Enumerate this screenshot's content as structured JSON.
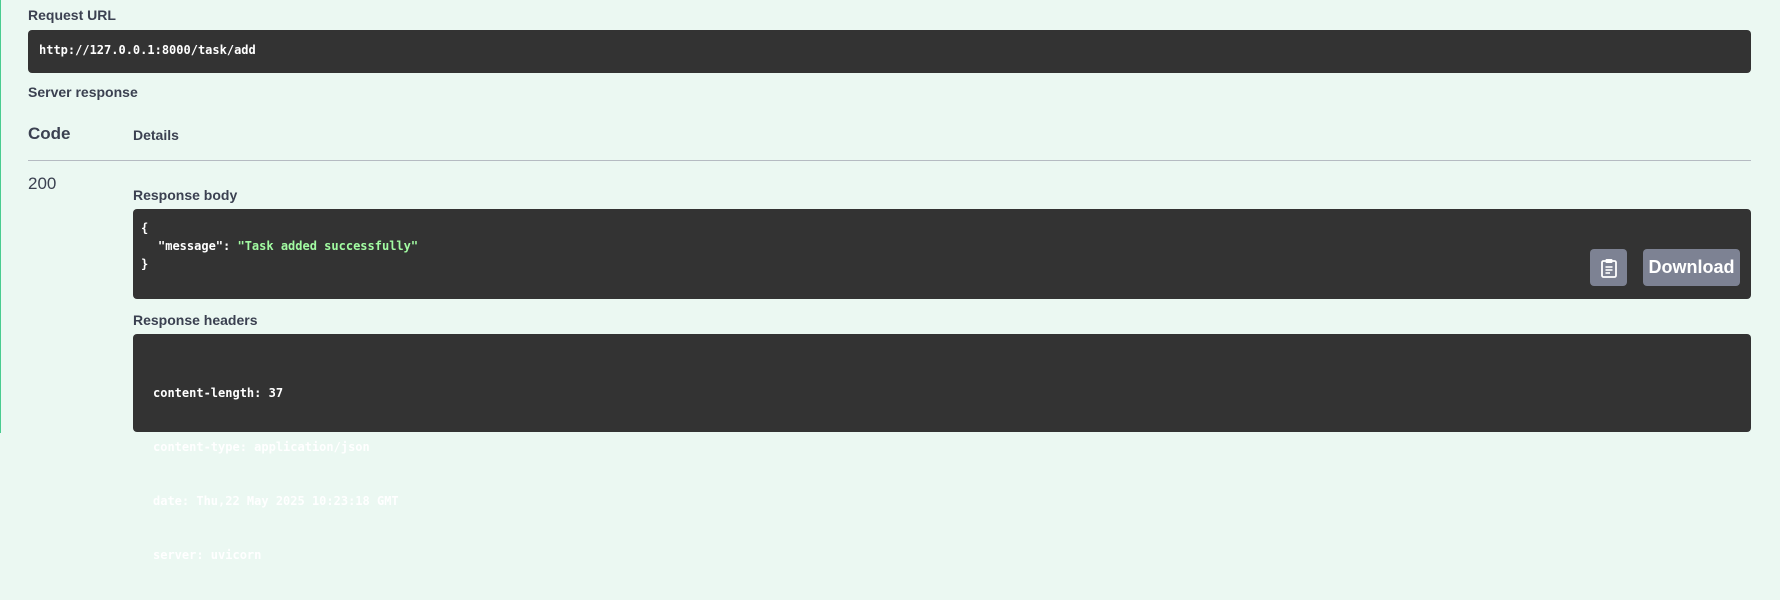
{
  "request": {
    "label": "Request URL",
    "url": "http://127.0.0.1:8000/task/add"
  },
  "response": {
    "label": "Server response",
    "columns": {
      "code": "Code",
      "details": "Details"
    },
    "status_code": "200",
    "body_label": "Response body",
    "body": {
      "open_brace": "{",
      "key": "\"message\"",
      "colon": ": ",
      "value": "\"Task added successfully\"",
      "close_brace": "}"
    },
    "headers_label": "Response headers",
    "headers": [
      "content-length: 37",
      "content-type: application/json",
      "date: Thu,22 May 2025 10:23:18 GMT",
      "server: uvicorn"
    ],
    "download_label": "Download",
    "copy_icon": "clipboard-icon"
  },
  "colors": {
    "background": "#ebf8f2",
    "accent": "#49cc90",
    "code_bg": "#333333",
    "button_bg": "#7d8293",
    "json_string": "#a2fca2"
  }
}
